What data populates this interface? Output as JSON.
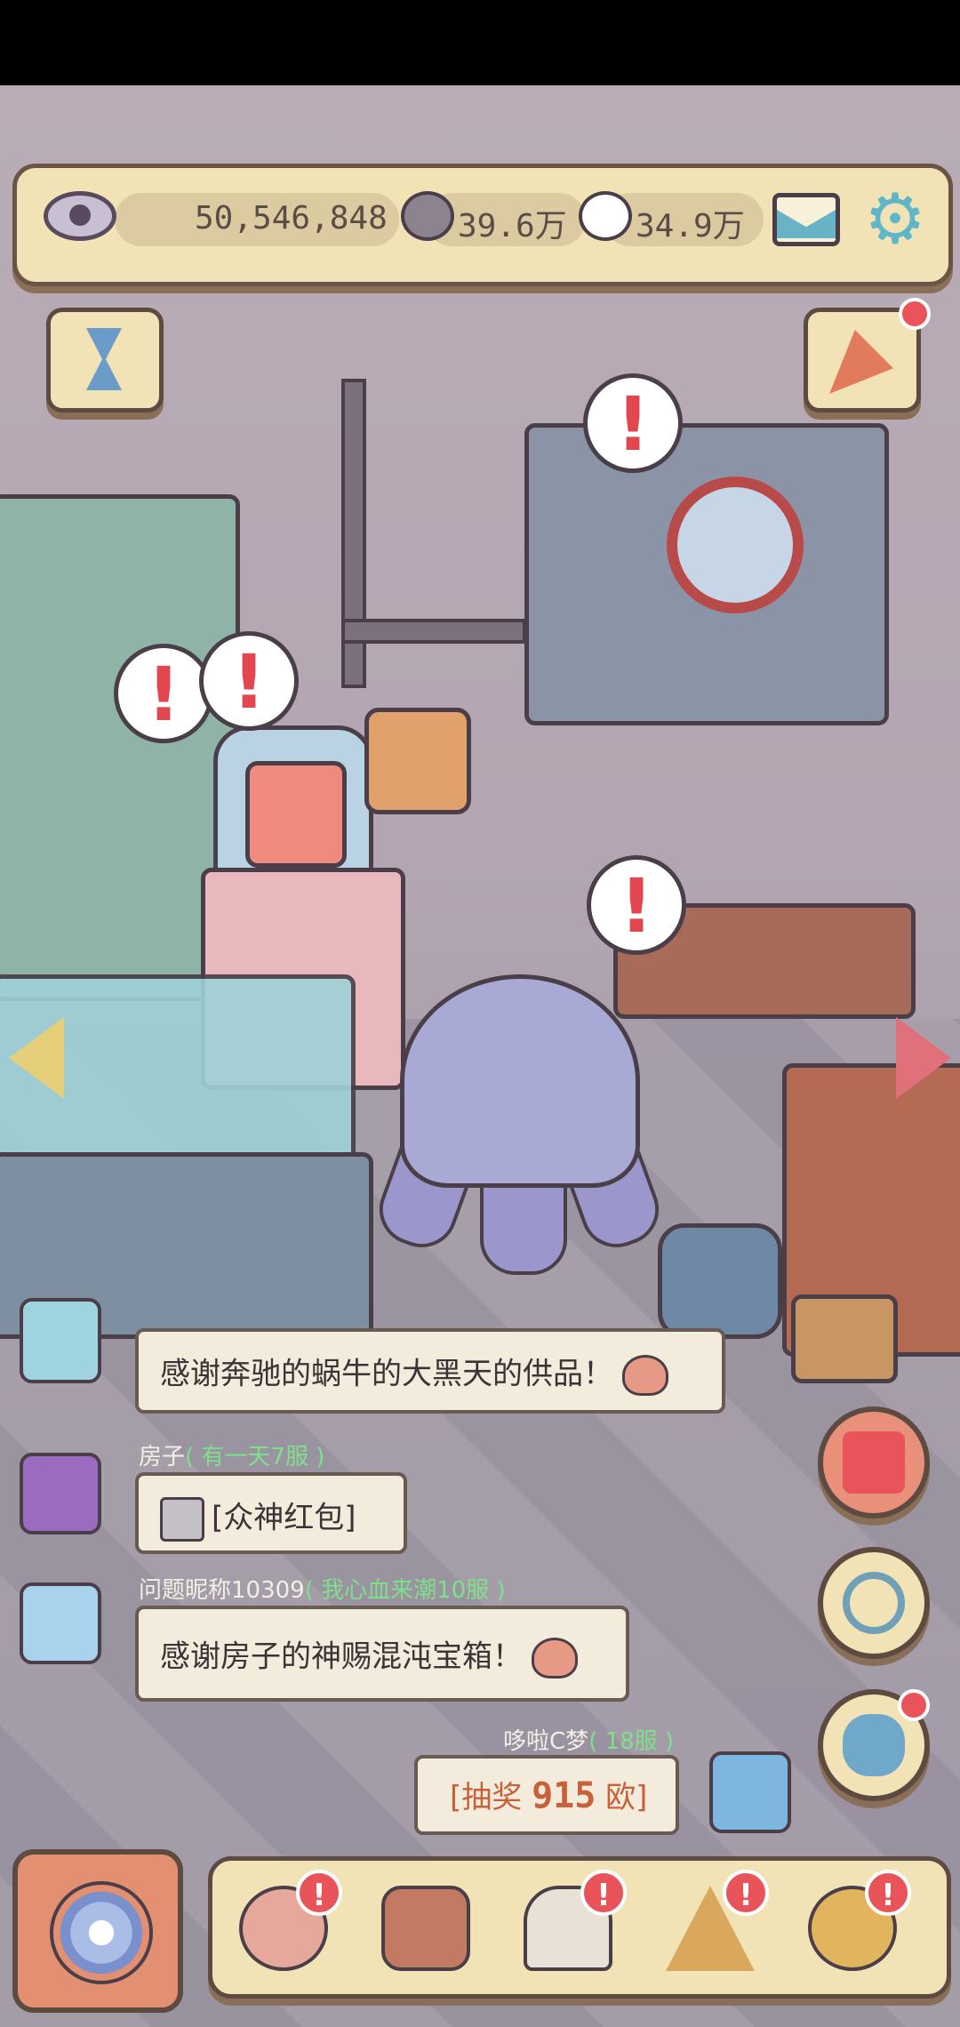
{
  "resources": {
    "eye_value": "50,546,848",
    "gray_bubble_value": "39.6万",
    "white_bubble_value": "34.9万"
  },
  "alerts": {
    "mark": "!"
  },
  "chat": {
    "messages": [
      {
        "name": "",
        "server": "",
        "text": "感谢奔驰的蜗牛的大黑天的供品！"
      },
      {
        "name": "房子",
        "server": "( 有一天7服 )",
        "text": "[众神红包]"
      },
      {
        "name": "问题昵称10309",
        "server": "( 我心血来潮10服 )",
        "text": "感谢房子的神赐混沌宝箱！"
      },
      {
        "name": "哆啦C梦",
        "server": "( 18服 )",
        "text_prefix": "[抽奖 ",
        "text_value": "915",
        "text_suffix": " 欧]"
      }
    ]
  },
  "dock": {
    "badge_mark": "!",
    "items": [
      "snail-icon",
      "backpack-icon",
      "statue-icon",
      "pyramid-eye-icon",
      "key-icon"
    ]
  },
  "colors": {
    "panel": "#f2e3b6",
    "outline": "#5d4a40",
    "alert_red": "#e2464f",
    "server_green": "#7fe08a",
    "lottery_orange": "#c8613a"
  }
}
